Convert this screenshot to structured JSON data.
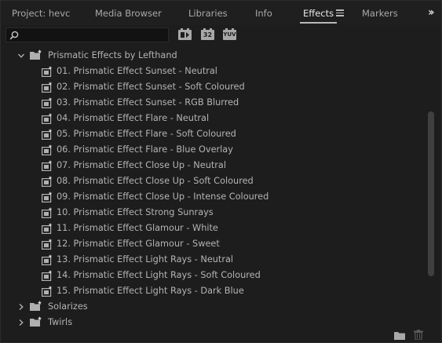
{
  "tabs": [
    {
      "label": "Project: hevc",
      "active": false
    },
    {
      "label": "Media Browser",
      "active": false
    },
    {
      "label": "Libraries",
      "active": false
    },
    {
      "label": "Info",
      "active": false
    },
    {
      "label": "Effects",
      "active": true
    },
    {
      "label": "Markers",
      "active": false
    }
  ],
  "overflow_icon": "double-chevron-right-icon",
  "search": {
    "value": "",
    "placeholder": ""
  },
  "filter_buttons": [
    {
      "icon": "accelerated-effects-icon"
    },
    {
      "label": "32",
      "icon": "32bit-color-effects-icon"
    },
    {
      "label": "YUV",
      "icon": "yuv-effects-icon"
    }
  ],
  "tree": {
    "expanded_bin": "Prismatic Effects by Lefthand",
    "effects": [
      "01. Prismatic Effect Sunset - Neutral",
      "02. Prismatic Effect Sunset - Soft Coloured",
      "03. Prismatic Effect Sunset - RGB Blurred",
      "04. Prismatic Effect Flare  - Neutral",
      "05. Prismatic Effect Flare  - Soft Coloured",
      "06. Prismatic Effect Flare  - Blue Overlay",
      "07. Prismatic Effect Close Up - Neutral",
      "08. Prismatic Effect Close Up - Soft Coloured",
      "09. Prismatic Effect Close Up  - Intense Coloured",
      "10. Prismatic Effect Strong Sunrays",
      "11. Prismatic Effect Glamour - White",
      "12. Prismatic Effect Glamour - Sweet",
      "13. Prismatic Effect Light Rays - Neutral",
      "14. Prismatic Effect Light Rays - Soft Coloured",
      "15. Prismatic Effect Light Rays - Dark Blue"
    ],
    "collapsed_bins": [
      "Solarizes",
      "Twirls"
    ]
  },
  "bottom": {
    "new_bin_icon": "new-custom-bin-icon",
    "delete_icon": "trash-icon"
  },
  "colors": {
    "background": "#1d1d1d",
    "text": "#b4b4b4",
    "active_tab": "#e8e8e8",
    "scrollbar": "#3f3f3f"
  }
}
